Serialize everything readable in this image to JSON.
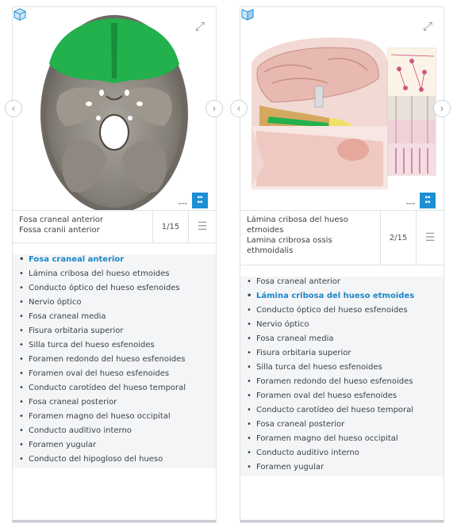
{
  "colors": {
    "accent": "#1b87c9",
    "highlight_green": "#22b14c",
    "badge_blue": "#1d8fd6"
  },
  "icons": {
    "expand": "expand-icon",
    "prev": "chevron-left-icon",
    "next": "chevron-right-icon",
    "menu": "list-menu-icon",
    "cube": "3d-cube-icon"
  },
  "left": {
    "caption_es": "Fosa craneal anterior",
    "caption_la": "Fossa cranii anterior",
    "counter": "1/15",
    "active_index": 0,
    "items": [
      "Fosa craneal anterior",
      "Lámina cribosa del hueso etmoides",
      "Conducto óptico del hueso esfenoides",
      "Nervio óptico",
      "Fosa craneal media",
      "Fisura orbitaria superior",
      "Silla turca del hueso esfenoides",
      "Foramen redondo del hueso esfenoides",
      "Foramen oval del hueso esfenoides",
      "Conducto carotídeo del hueso temporal",
      "Fosa craneal posterior",
      "Foramen magno del hueso occipital",
      "Conducto auditivo interno",
      "Foramen yugular",
      "Conducto del hipogloso del hueso"
    ]
  },
  "right": {
    "caption_es": "Lámina cribosa del hueso etmoides",
    "caption_la": "Lamina cribrosa ossis ethmoidalis",
    "counter": "2/15",
    "active_index": 1,
    "items": [
      "Fosa craneal anterior",
      "Lámina cribosa del hueso etmoides",
      "Conducto óptico del hueso esfenoides",
      "Nervio óptico",
      "Fosa craneal media",
      "Fisura orbitaria superior",
      "Silla turca del hueso esfenoides",
      "Foramen redondo del hueso esfenoides",
      "Foramen oval del hueso esfenoides",
      "Conducto carotídeo del hueso temporal",
      "Fosa craneal posterior",
      "Foramen magno del hueso occipital",
      "Conducto auditivo interno",
      "Foramen yugular"
    ]
  }
}
